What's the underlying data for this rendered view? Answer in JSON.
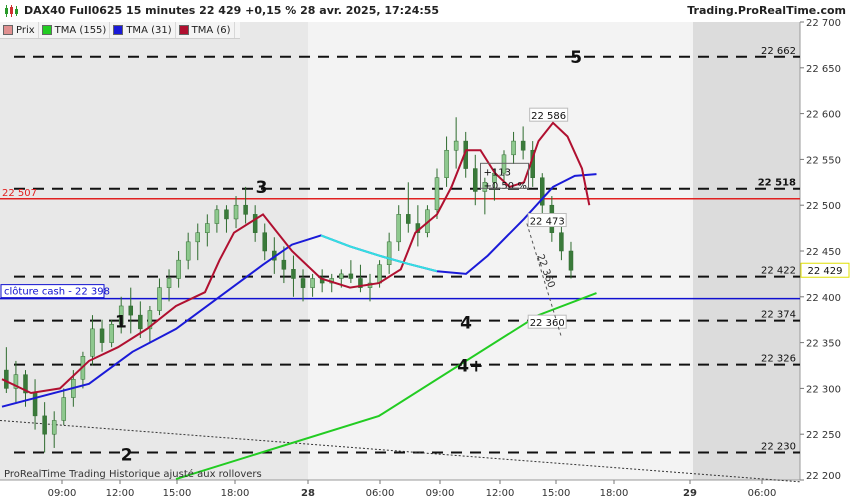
{
  "header": {
    "title": "DAX40 Full0625 15 minutes 22 429 +0,15 % 28 avr. 2025, 17:24:55",
    "site": "Trading.ProRealTime.com"
  },
  "legend": [
    {
      "label": "Prix",
      "color": "#e09090"
    },
    {
      "label": "TMA (155)",
      "color": "#22cc22"
    },
    {
      "label": "TMA (31)",
      "color": "#1a1ad8"
    },
    {
      "label": "TMA (6)",
      "color": "#b01030"
    }
  ],
  "footer_note": "ProRealTime Trading  Historique ajusté aux rollovers",
  "chart_data": {
    "type": "candlestick",
    "symbol": "DAX40 Full0625",
    "timeframe": "15 minutes",
    "ylim": [
      22200,
      22700
    ],
    "y_ticks": [
      "22 200",
      "22 250",
      "22 300",
      "22 350",
      "22 400",
      "22 450",
      "22 500",
      "22 550",
      "22 600",
      "22 650",
      "22 700"
    ],
    "x_ticks": [
      {
        "label": "09:00",
        "bold": false
      },
      {
        "label": "12:00",
        "bold": false
      },
      {
        "label": "15:00",
        "bold": false
      },
      {
        "label": "18:00",
        "bold": false
      },
      {
        "label": "28",
        "bold": true
      },
      {
        "label": "06:00",
        "bold": false
      },
      {
        "label": "09:00",
        "bold": false
      },
      {
        "label": "12:00",
        "bold": false
      },
      {
        "label": "15:00",
        "bold": false
      },
      {
        "label": "18:00",
        "bold": false
      },
      {
        "label": "29",
        "bold": true
      },
      {
        "label": "06:00",
        "bold": false
      }
    ],
    "last_price": "22 429",
    "horizontal_levels": [
      {
        "value": 22662,
        "label": "22 662",
        "style": "dashed"
      },
      {
        "value": 22518,
        "label": "22 518",
        "style": "dashed"
      },
      {
        "value": 22422,
        "label": "22 422",
        "style": "dashed"
      },
      {
        "value": 22374,
        "label": "22 374",
        "style": "dashed"
      },
      {
        "value": 22326,
        "label": "22 326",
        "style": "dashed"
      },
      {
        "value": 22230,
        "label": "22 230",
        "style": "dashed"
      }
    ],
    "red_line": {
      "value": 22507,
      "label": "22 507",
      "color": "#e02020"
    },
    "blue_line": {
      "value": 22398,
      "label": "clôture cash -  22 398",
      "color": "#1010d0"
    },
    "wave_labels": [
      {
        "text": "1",
        "value": 22373,
        "time": 8.2
      },
      {
        "text": "2",
        "value": 22228,
        "time": 8.6
      },
      {
        "text": "3",
        "value": 22520,
        "time": 17.9
      },
      {
        "text": "4",
        "value": 22372,
        "time": 32.0
      },
      {
        "text": "4+",
        "value": 22325,
        "time": 32.3
      },
      {
        "text": "5",
        "value": 22662,
        "time": 39.6
      }
    ],
    "annotations": [
      {
        "text": "22 586",
        "value": 22595,
        "time": 37.7
      },
      {
        "text": "22 473",
        "value": 22480,
        "time": 37.6
      },
      {
        "text": "22 360",
        "value": 22369,
        "time": 37.6
      },
      {
        "text": "+113",
        "value": 22537,
        "time": 35.0
      },
      {
        "text": "+0,50 %",
        "value": 22522,
        "time": 35.0
      }
    ],
    "measure_label": "22 360",
    "tma155": {
      "points": [
        [
          12,
          22201
        ],
        [
          26,
          22270
        ],
        [
          37,
          22380
        ],
        [
          41,
          22404
        ]
      ]
    },
    "tma31": {
      "points": [
        [
          0,
          22280
        ],
        [
          6,
          22305
        ],
        [
          9,
          22340
        ],
        [
          12,
          22365
        ],
        [
          15,
          22400
        ],
        [
          18,
          22435
        ],
        [
          20,
          22457
        ],
        [
          22,
          22467
        ],
        [
          24,
          22455
        ],
        [
          26,
          22445
        ],
        [
          28,
          22436
        ],
        [
          30,
          22428
        ],
        [
          32,
          22425
        ],
        [
          33.5,
          22445
        ],
        [
          36,
          22485
        ],
        [
          38,
          22520
        ],
        [
          39.5,
          22532
        ],
        [
          41,
          22534
        ]
      ]
    },
    "tma6": {
      "points": [
        [
          0,
          22310
        ],
        [
          2,
          22295
        ],
        [
          4,
          22300
        ],
        [
          6,
          22330
        ],
        [
          8,
          22345
        ],
        [
          10,
          22365
        ],
        [
          12,
          22390
        ],
        [
          14,
          22405
        ],
        [
          15,
          22440
        ],
        [
          16,
          22470
        ],
        [
          17,
          22480
        ],
        [
          18,
          22490
        ],
        [
          19,
          22470
        ],
        [
          20,
          22450
        ],
        [
          22,
          22420
        ],
        [
          24,
          22410
        ],
        [
          26,
          22415
        ],
        [
          27.5,
          22430
        ],
        [
          28.5,
          22470
        ],
        [
          30,
          22490
        ],
        [
          31,
          22520
        ],
        [
          32,
          22560
        ],
        [
          33,
          22560
        ],
        [
          34,
          22535
        ],
        [
          35,
          22520
        ],
        [
          36,
          22525
        ],
        [
          37,
          22570
        ],
        [
          38,
          22590
        ],
        [
          39,
          22575
        ],
        [
          40,
          22540
        ],
        [
          40.5,
          22500
        ]
      ]
    },
    "candles": [
      [
        22320,
        22345,
        22295,
        22300
      ],
      [
        22300,
        22330,
        22285,
        22315
      ],
      [
        22315,
        22320,
        22280,
        22295
      ],
      [
        22295,
        22310,
        22255,
        22270
      ],
      [
        22270,
        22285,
        22230,
        22250
      ],
      [
        22250,
        22275,
        22235,
        22265
      ],
      [
        22265,
        22300,
        22260,
        22290
      ],
      [
        22290,
        22320,
        22280,
        22310
      ],
      [
        22310,
        22340,
        22300,
        22335
      ],
      [
        22335,
        22380,
        22325,
        22365
      ],
      [
        22365,
        22375,
        22340,
        22350
      ],
      [
        22350,
        22375,
        22345,
        22370
      ],
      [
        22370,
        22400,
        22360,
        22390
      ],
      [
        22390,
        22410,
        22360,
        22380
      ],
      [
        22380,
        22395,
        22355,
        22365
      ],
      [
        22365,
        22390,
        22350,
        22385
      ],
      [
        22385,
        22420,
        22380,
        22410
      ],
      [
        22410,
        22430,
        22395,
        22420
      ],
      [
        22420,
        22450,
        22410,
        22440
      ],
      [
        22440,
        22470,
        22430,
        22460
      ],
      [
        22460,
        22480,
        22440,
        22470
      ],
      [
        22470,
        22490,
        22455,
        22480
      ],
      [
        22480,
        22500,
        22470,
        22495
      ],
      [
        22495,
        22500,
        22470,
        22485
      ],
      [
        22485,
        22510,
        22475,
        22500
      ],
      [
        22500,
        22520,
        22480,
        22490
      ],
      [
        22490,
        22500,
        22460,
        22470
      ],
      [
        22470,
        22480,
        22440,
        22450
      ],
      [
        22450,
        22465,
        22425,
        22440
      ],
      [
        22440,
        22455,
        22415,
        22430
      ],
      [
        22430,
        22445,
        22400,
        22420
      ],
      [
        22420,
        22430,
        22395,
        22410
      ],
      [
        22410,
        22425,
        22400,
        22420
      ],
      [
        22420,
        22430,
        22405,
        22415
      ],
      [
        22415,
        22425,
        22405,
        22420
      ],
      [
        22420,
        22430,
        22410,
        22425
      ],
      [
        22425,
        22440,
        22415,
        22420
      ],
      [
        22420,
        22435,
        22405,
        22410
      ],
      [
        22410,
        22425,
        22395,
        22415
      ],
      [
        22415,
        22440,
        22410,
        22435
      ],
      [
        22435,
        22470,
        22425,
        22460
      ],
      [
        22460,
        22500,
        22450,
        22490
      ],
      [
        22490,
        22525,
        22470,
        22480
      ],
      [
        22480,
        22500,
        22455,
        22470
      ],
      [
        22470,
        22500,
        22465,
        22495
      ],
      [
        22495,
        22540,
        22485,
        22530
      ],
      [
        22530,
        22575,
        22520,
        22560
      ],
      [
        22560,
        22596,
        22540,
        22570
      ],
      [
        22570,
        22580,
        22530,
        22540
      ],
      [
        22540,
        22555,
        22500,
        22515
      ],
      [
        22515,
        22530,
        22490,
        22525
      ],
      [
        22525,
        22540,
        22505,
        22535
      ],
      [
        22535,
        22560,
        22525,
        22555
      ],
      [
        22555,
        22580,
        22545,
        22570
      ],
      [
        22570,
        22586,
        22550,
        22560
      ],
      [
        22560,
        22570,
        22520,
        22530
      ],
      [
        22530,
        22535,
        22490,
        22500
      ],
      [
        22500,
        22510,
        22460,
        22470
      ],
      [
        22470,
        22480,
        22440,
        22450
      ],
      [
        22450,
        22460,
        22420,
        22429
      ]
    ]
  }
}
